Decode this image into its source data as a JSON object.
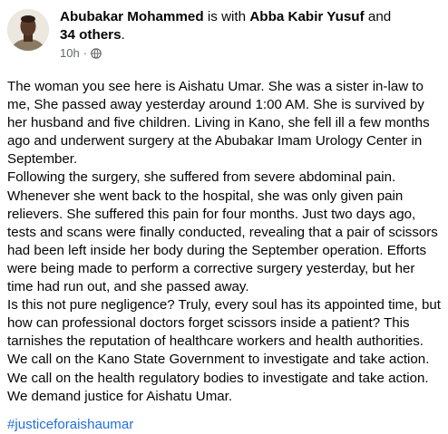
{
  "author": {
    "name": "Abubakar Mohammed",
    "connector_with": "is with",
    "tagged": "Abba Kabir Yusuf",
    "connector_and": "and",
    "others": "34 others",
    "period": "."
  },
  "meta": {
    "timestamp": "10h",
    "separator": "·",
    "audience_icon": "globe-icon"
  },
  "paragraphs": [
    "The woman you see here is Aishatu Umar. She was a sister in-law to me, She passed away yesterday around 1:00 AM. She is survived by her husband and five children. Living in Kano, she fell ill a few months ago and underwent surgery at the Abubakar Imam Urology Center in September.",
    "Following the surgery, she suffered from severe abdominal pain. Whenever she went back to the hospital, she was only given pain relievers. She suffered this pain for four months. Just two days ago, tests and scans were finally conducted, revealing that a pair of scissors had been left inside her body during the September operation. Efforts were being made to perform a corrective surgery yesterday, but her time had run out, and she passed away.",
    "Is this not pure negligence? Truly, every soul has its appointed time, but how can professional doctors forget scissors inside a patient? This tarnishes the reputation of healthcare workers and health authorities.",
    "We call on the Kano State Government to investigate and take action.",
    "We call on the health regulatory bodies to investigate and take action.",
    "We demand justice for Aishatu Umar."
  ],
  "hashtag": "#justiceforaishaumar",
  "colors": {
    "text": "#050505",
    "secondary": "#65676b",
    "link": "#216fdb"
  }
}
